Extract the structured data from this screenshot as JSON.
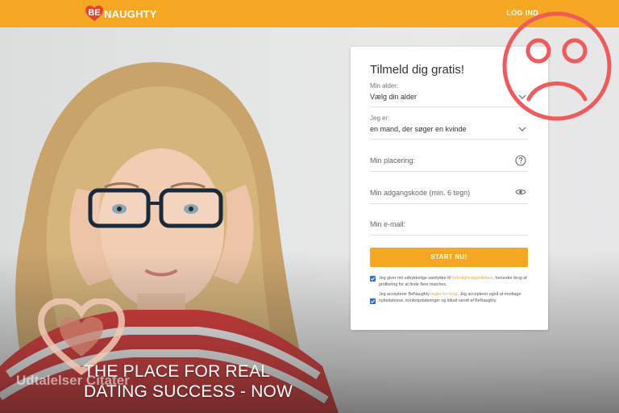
{
  "header": {
    "logo_badge": "BE",
    "logo_word": "NAUGHTY",
    "login_label": "LOG IND"
  },
  "signup": {
    "title": "Tilmeld dig gratis!",
    "age": {
      "label": "Min alder:",
      "value": "Vælg din alder"
    },
    "gender": {
      "label": "Jeg er:",
      "value": "en mand, der søger en kvinde"
    },
    "location": {
      "placeholder": "Min placering:"
    },
    "password": {
      "placeholder": "Min adgangskode (min. 6 tegn)"
    },
    "email": {
      "placeholder": "Min e-mail:"
    },
    "start_label": "START NU!",
    "consent1": {
      "before": "Jeg giver mit udtrykkelige samtykke til ",
      "link": "fortrolighedspolitikken",
      "after": ", herunder brug af profilering for at finde flere matches."
    },
    "consent2": {
      "before": "Jeg accepterer BeNaughty ",
      "link": "regler for brug",
      "after": ". Jeg accepterer også at modtage nyhedsbreve, kontoopdateringer og tilbud sendt af BeNaughty."
    }
  },
  "hero": {
    "tagline_line1": "THE PLACE FOR REAL",
    "tagline_line2": "DATING SUCCESS - NOW",
    "watermark": "Udtalelser Citater"
  },
  "colors": {
    "brand": "#f5a623",
    "sad_face": "#f05a5a",
    "checkbox": "#2b6fd6"
  },
  "icons": [
    "heart-logo-icon",
    "chevron-down-icon",
    "question-icon",
    "eye-icon",
    "checkbox-checked-icon",
    "sad-face-icon",
    "watermark-heart-icon"
  ]
}
